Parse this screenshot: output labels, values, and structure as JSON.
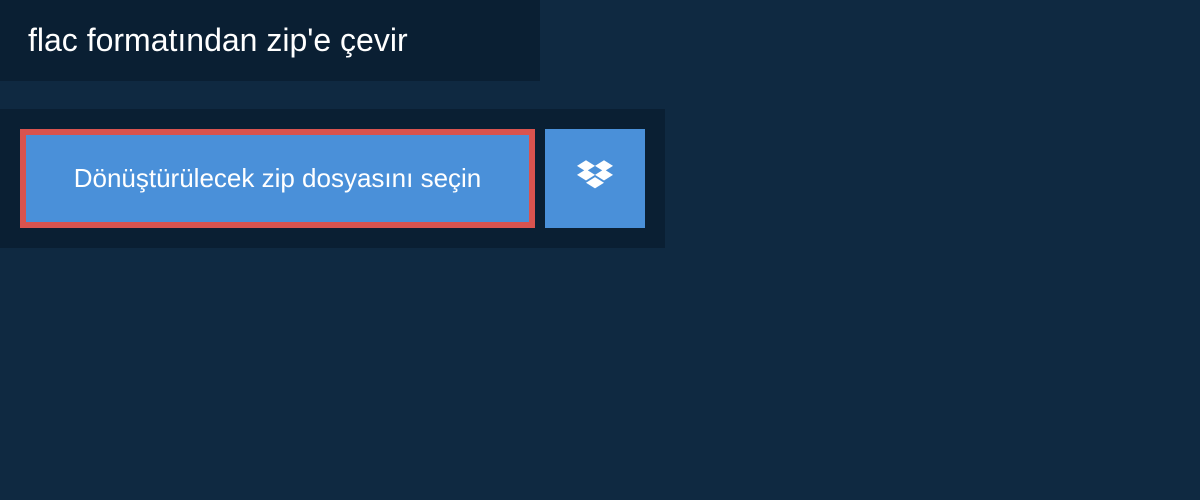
{
  "header": {
    "title": "flac formatından zip'e çevir"
  },
  "upload": {
    "select_file_label": "Dönüştürülecek zip dosyasını seçin"
  }
}
